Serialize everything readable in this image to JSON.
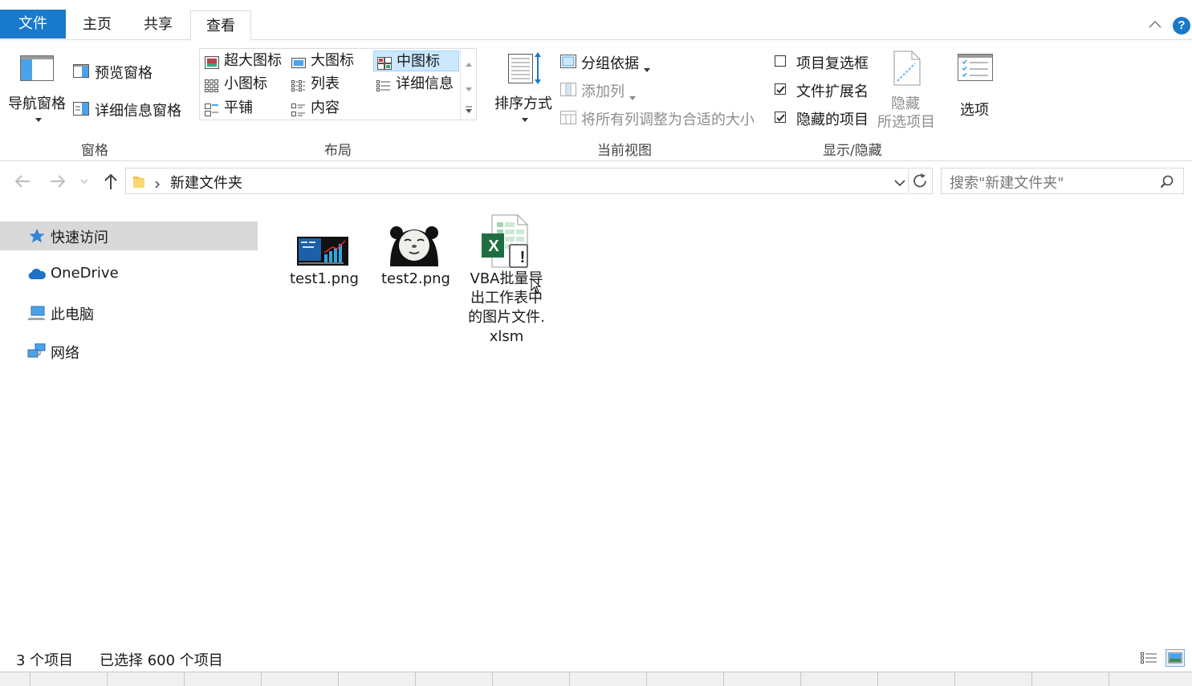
{
  "tabs": {
    "file": "文件",
    "home": "主页",
    "share": "共享",
    "view": "查看"
  },
  "help_glyph": "?",
  "ribbon": {
    "panes": {
      "group_label": "窗格",
      "nav_pane": "导航窗格",
      "preview_pane": "预览窗格",
      "details_pane": "详细信息窗格"
    },
    "layout": {
      "group_label": "布局",
      "extra_large": "超大图标",
      "large": "大图标",
      "medium": "中图标",
      "small": "小图标",
      "list": "列表",
      "details": "详细信息",
      "tiles": "平铺",
      "content": "内容",
      "selected": "中图标"
    },
    "current_view": {
      "group_label": "当前视图",
      "sort_by": "排序方式",
      "group_by": "分组依据",
      "add_columns": "添加列",
      "size_all_columns": "将所有列调整为合适的大小"
    },
    "show_hide": {
      "group_label": "显示/隐藏",
      "item_checkboxes": "项目复选框",
      "item_checkboxes_checked": false,
      "file_extensions": "文件扩展名",
      "file_extensions_checked": true,
      "hidden_items": "隐藏的项目",
      "hidden_items_checked": true,
      "hide_selected_1": "隐藏",
      "hide_selected_2": "所选项目",
      "options": "选项"
    }
  },
  "address": {
    "path": "新建文件夹",
    "search_placeholder": "搜索\"新建文件夹\""
  },
  "nav_pane": {
    "items": [
      {
        "label": "快速访问",
        "icon": "star-icon"
      },
      {
        "label": "OneDrive",
        "icon": "cloud-icon"
      },
      {
        "label": "此电脑",
        "icon": "computer-icon"
      },
      {
        "label": "网络",
        "icon": "network-icon"
      }
    ]
  },
  "files": [
    {
      "name": "test1.png",
      "icon": "image-thumbnail"
    },
    {
      "name": "test2.png",
      "icon": "panda-meme-thumbnail"
    },
    {
      "name": "VBA批量导出工作表中的图片文件.xlsm",
      "icon": "excel-macro-icon",
      "excel_letter": "X",
      "warning_glyph": "!"
    }
  ],
  "status": {
    "count": "3 个项目",
    "selected": "已选择 600 个项目"
  },
  "colors": {
    "accent": "#1979ca",
    "selection": "#cce8ff",
    "nav_highlight": "#d9d9d9",
    "excel_green": "#1d6f42"
  }
}
